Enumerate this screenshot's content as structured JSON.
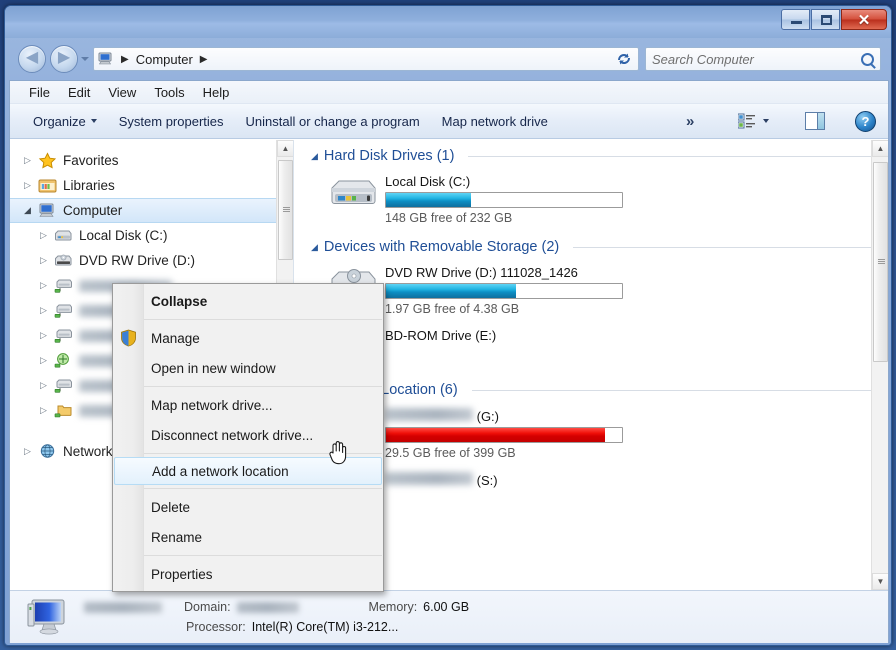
{
  "window": {
    "controls": {
      "minimize": "–",
      "maximize": "□",
      "close": "✕"
    }
  },
  "address": {
    "computer_icon": "computer-icon",
    "crumb": "Computer",
    "separator": "▶",
    "refresh_label": "↻"
  },
  "search": {
    "placeholder": "Search Computer"
  },
  "menubar": {
    "items": [
      "File",
      "Edit",
      "View",
      "Tools",
      "Help"
    ]
  },
  "commandbar": {
    "organize": "Organize",
    "system_properties": "System properties",
    "uninstall": "Uninstall or change a program",
    "map_network_drive": "Map network drive",
    "overflow": "»",
    "help": "?"
  },
  "navpane": {
    "items": [
      {
        "label": "Favorites",
        "icon": "star-icon",
        "expander": "▷",
        "indent": 0,
        "selected": false,
        "blurred": false
      },
      {
        "label": "Libraries",
        "icon": "libraries-icon",
        "expander": "▷",
        "indent": 0,
        "selected": false,
        "blurred": false
      },
      {
        "label": "Computer",
        "icon": "computer-icon",
        "expander": "◢",
        "indent": 0,
        "selected": true,
        "blurred": false
      },
      {
        "label": "Local Disk (C:)",
        "icon": "harddisk-icon",
        "expander": "▷",
        "indent": 1,
        "selected": false,
        "blurred": false
      },
      {
        "label": "DVD RW Drive (D:)",
        "icon": "dvd-icon",
        "expander": "▷",
        "indent": 1,
        "selected": false,
        "blurred": false
      },
      {
        "label": "network drive G",
        "icon": "network-drive-icon",
        "expander": "▷",
        "indent": 1,
        "selected": false,
        "blurred": true
      },
      {
        "label": "network drive S",
        "icon": "network-drive-icon",
        "expander": "▷",
        "indent": 1,
        "selected": false,
        "blurred": true
      },
      {
        "label": "network drive T",
        "icon": "network-drive-icon",
        "expander": "▷",
        "indent": 1,
        "selected": false,
        "blurred": true
      },
      {
        "label": "network drive A",
        "icon": "network-drive-green-icon",
        "expander": "▷",
        "indent": 1,
        "selected": false,
        "blurred": true
      },
      {
        "label": "network drive U",
        "icon": "network-drive-icon",
        "expander": "▷",
        "indent": 1,
        "selected": false,
        "blurred": true
      },
      {
        "label": "mapped folder",
        "icon": "network-folder-icon",
        "expander": "▷",
        "indent": 1,
        "selected": false,
        "blurred": true
      },
      {
        "label": "Network",
        "icon": "network-icon",
        "expander": "▷",
        "indent": 0,
        "selected": false,
        "blurred": false
      }
    ]
  },
  "content": {
    "groups": [
      {
        "title": "Hard Disk Drives (1)",
        "caret": "◢",
        "drives": [
          {
            "name": "Local Disk (C:)",
            "icon": "harddisk-icon",
            "has_bar": true,
            "percent_used": 36,
            "bar_color": "blue",
            "free": "148 GB free of 232 GB",
            "blurred_name": false
          }
        ]
      },
      {
        "title": "Devices with Removable Storage (2)",
        "caret": "◢",
        "drives": [
          {
            "name": "DVD RW Drive (D:) 111028_1426",
            "icon": "dvd-icon",
            "has_bar": true,
            "percent_used": 55,
            "bar_color": "blue",
            "free": "1.97 GB free of 4.38 GB",
            "blurred_name": false
          },
          {
            "name": "BD-ROM Drive (E:)",
            "icon": "bdrom-icon",
            "has_bar": false,
            "percent_used": 0,
            "bar_color": "blue",
            "free": "",
            "blurred_name": false
          }
        ]
      },
      {
        "title": "Network Location (6)",
        "caret": "◢",
        "drives": [
          {
            "name": "Group Quota (G:)",
            "icon": "network-drive-icon",
            "has_bar": true,
            "percent_used": 93,
            "bar_color": "red",
            "free": "29.5 GB free of 399 GB",
            "blurred_name": true
          },
          {
            "name": "Share Folder (S:)",
            "icon": "network-drive-icon",
            "has_bar": false,
            "percent_used": 0,
            "bar_color": "blue",
            "free": "",
            "blurred_name": true
          }
        ]
      }
    ]
  },
  "contextmenu": {
    "items": [
      {
        "label": "Collapse",
        "bold": true,
        "highlighted": false,
        "shield": false,
        "sep_after": true
      },
      {
        "label": "Manage",
        "bold": false,
        "highlighted": false,
        "shield": true,
        "sep_after": false
      },
      {
        "label": "Open in new window",
        "bold": false,
        "highlighted": false,
        "shield": false,
        "sep_after": true
      },
      {
        "label": "Map network drive...",
        "bold": false,
        "highlighted": false,
        "shield": false,
        "sep_after": false
      },
      {
        "label": "Disconnect network drive...",
        "bold": false,
        "highlighted": false,
        "shield": false,
        "sep_after": true
      },
      {
        "label": "Add a network location",
        "bold": false,
        "highlighted": true,
        "shield": false,
        "sep_after": true
      },
      {
        "label": "Delete",
        "bold": false,
        "highlighted": false,
        "shield": false,
        "sep_after": false
      },
      {
        "label": "Rename",
        "bold": false,
        "highlighted": false,
        "shield": false,
        "sep_after": true
      },
      {
        "label": "Properties",
        "bold": false,
        "highlighted": false,
        "shield": false,
        "sep_after": false
      }
    ]
  },
  "statusbar": {
    "computer_name": "COMPUTERNAME",
    "domain_key": "Domain:",
    "domain_value": "DOMAIN",
    "memory_key": "Memory:",
    "memory_value": "6.00 GB",
    "processor_key": "Processor:",
    "processor_value": "Intel(R) Core(TM) i3-212..."
  },
  "colors": {
    "accent_blue": "#1f4e96",
    "bar_blue": "#0d8fc4",
    "bar_red": "#d40000",
    "titlebar": "#8fb0dd",
    "close_red": "#ba2f1c"
  }
}
